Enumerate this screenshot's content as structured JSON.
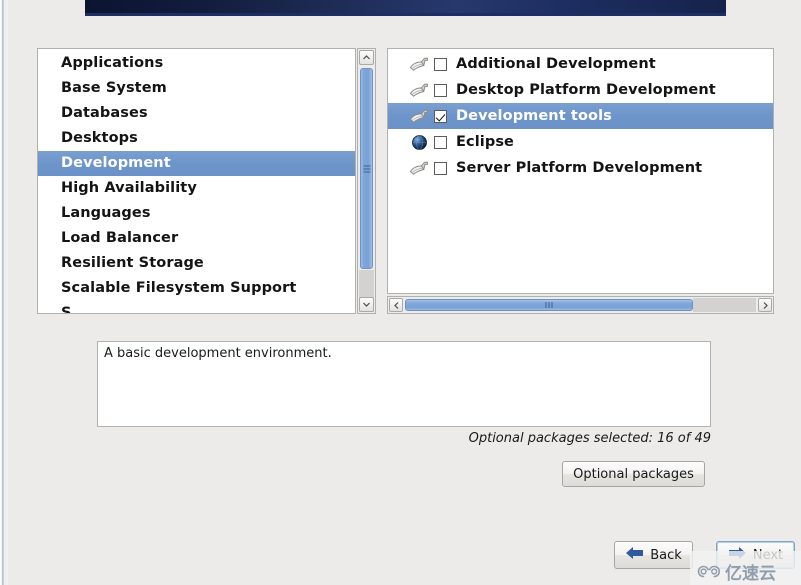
{
  "window": {
    "banner_color": "#1d2e63",
    "background_color": "#ecebe9"
  },
  "group_list": {
    "name": "package-group-list",
    "items": [
      {
        "label": "Applications",
        "selected": false
      },
      {
        "label": "Base System",
        "selected": false
      },
      {
        "label": "Databases",
        "selected": false
      },
      {
        "label": "Desktops",
        "selected": false
      },
      {
        "label": "Development",
        "selected": true
      },
      {
        "label": "High Availability",
        "selected": false
      },
      {
        "label": "Languages",
        "selected": false
      },
      {
        "label": "Load Balancer",
        "selected": false
      },
      {
        "label": "Resilient Storage",
        "selected": false
      },
      {
        "label": "Scalable Filesystem Support",
        "selected": false
      },
      {
        "label": "S",
        "selected": false,
        "clipped": true
      }
    ],
    "selected_label": "Development",
    "highlight_color": "#6e95ca"
  },
  "package_list": {
    "name": "package-option-list",
    "items": [
      {
        "label": "Additional Development",
        "checked": false,
        "selected": false,
        "icon": "package-group-icon"
      },
      {
        "label": "Desktop Platform Development",
        "checked": false,
        "selected": false,
        "icon": "package-group-icon"
      },
      {
        "label": "Development tools",
        "checked": true,
        "selected": true,
        "icon": "package-group-icon"
      },
      {
        "label": "Eclipse",
        "checked": false,
        "selected": false,
        "icon": "globe-icon"
      },
      {
        "label": "Server Platform Development",
        "checked": false,
        "selected": false,
        "icon": "package-group-icon"
      }
    ]
  },
  "description": {
    "text": "A basic development environment."
  },
  "optional": {
    "count_label": "Optional packages selected: 16 of 49",
    "selected_count": 16,
    "total_count": 49,
    "button_label": "Optional packages"
  },
  "navigation": {
    "back_label": "Back",
    "next_label": "Next",
    "back_icon": "arrow-left-icon",
    "next_icon": "arrow-right-icon",
    "accent_color": "#2f5a9e"
  },
  "watermark": {
    "text": "亿速云",
    "icon": "cloud-icon"
  }
}
